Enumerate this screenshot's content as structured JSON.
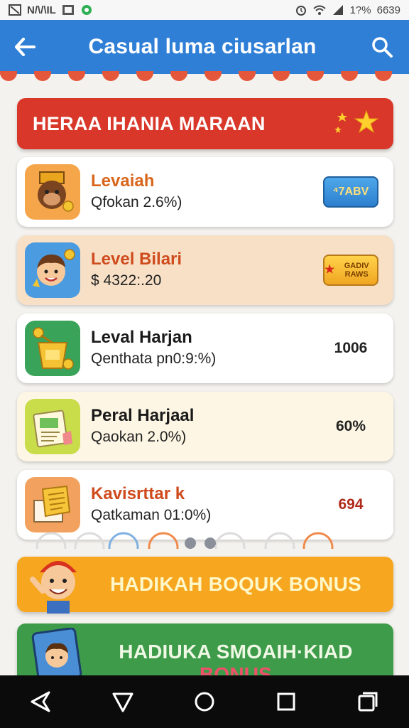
{
  "status_bar": {
    "left_text": "N/\\/\\IL",
    "right_text": "1?%",
    "time": "6639",
    "icons": [
      "notification-icon",
      "image-icon",
      "app-icon",
      "alarm-icon",
      "wifi-icon",
      "signal-icon"
    ]
  },
  "app_bar": {
    "title": "Casual luma ciusarlan",
    "back_icon": "arrow-left-icon",
    "search_icon": "search-icon",
    "color": "#2f7fd6"
  },
  "banner": {
    "title": "HERAA IHANIA MARAAN",
    "color": "#d8372a"
  },
  "items": [
    {
      "name": "Levaiah",
      "sub": "Qfokan 2.6%)",
      "right_type": "badge-blue",
      "right_text": "⁴7ABV",
      "icon": "monkey-icon",
      "bg": "#ffffff",
      "name_color": "#d9661c",
      "thumb_bg": "#f6a64a"
    },
    {
      "name": "Level Bilari",
      "sub": "$ 4322:.20",
      "right_type": "badge-gold",
      "right_text": "GADIV RAWS",
      "icon": "boy-icon",
      "bg": "#f7e0c6",
      "name_color": "#cf4a1c",
      "thumb_bg": "#4a9be0"
    },
    {
      "name": "Leval Harjan",
      "sub": "Qenthata pn0:9:%)",
      "right_type": "text",
      "right_text": "1006",
      "icon": "treasure-icon",
      "bg": "#ffffff",
      "name_color": "#1a1a1a",
      "thumb_bg": "#3aa35a"
    },
    {
      "name": "Peral Harjaal",
      "sub": "Qaokan 2.0%)",
      "right_type": "text",
      "right_text": "60%",
      "icon": "ticket-icon",
      "bg": "#fdf6e4",
      "name_color": "#1a1a1a",
      "thumb_bg": "#c9dc49"
    },
    {
      "name": "Kavisrttar k",
      "sub": "Qatkaman 01:0%)",
      "right_type": "text",
      "right_text": "694",
      "icon": "document-icon",
      "bg": "#ffffff",
      "name_color": "#cf4a1c",
      "thumb_bg": "#f2a25e",
      "right_color": "#b02a1a"
    }
  ],
  "bonus_buttons": [
    {
      "label": "HADIKAH BOQUK BONUS",
      "color": "#f6a61f",
      "icon": "character-icon"
    },
    {
      "label_main": "HADIUKA SMOAIH·KIAD ",
      "label_accent": "BONUS",
      "color": "#3d9b4a",
      "accent_color": "#f0506a",
      "icon": "photo-card-icon"
    }
  ],
  "nav_bar": {
    "icons": [
      "back-nav-icon",
      "triangle-nav-icon",
      "home-circle-icon",
      "recents-square-icon",
      "switch-app-icon"
    ]
  }
}
